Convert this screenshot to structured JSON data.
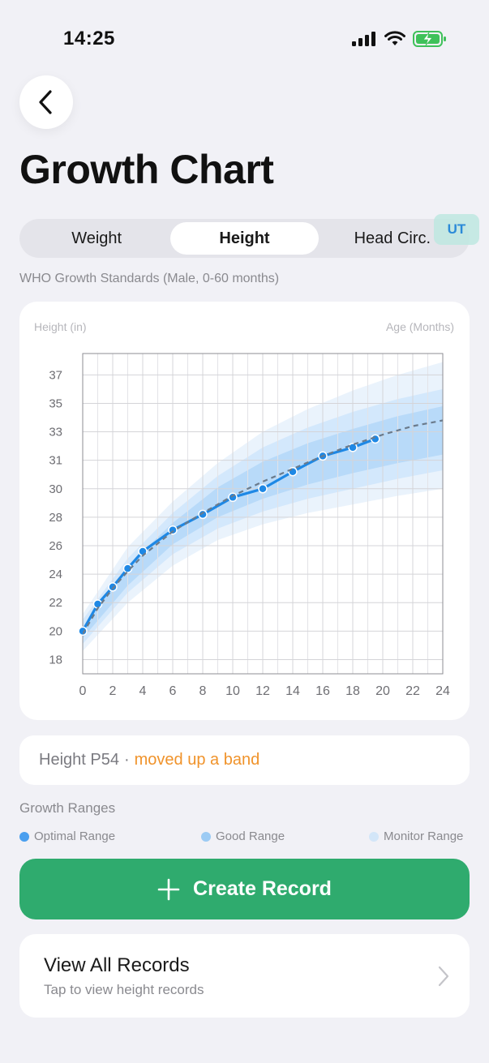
{
  "status_bar": {
    "time": "14:25"
  },
  "page": {
    "title": "Growth Chart"
  },
  "tabs": [
    {
      "label": "Weight",
      "active": false
    },
    {
      "label": "Height",
      "active": true
    },
    {
      "label": "Head Circ.",
      "active": false
    }
  ],
  "badge": {
    "label": "UT"
  },
  "subtitle": "WHO Growth Standards (Male, 0-60 months)",
  "chart_data": {
    "type": "line",
    "ylabel": "Height (in)",
    "xlabel": "Age (Months)",
    "x_ticks": [
      0,
      2,
      4,
      6,
      8,
      10,
      12,
      14,
      16,
      18,
      20,
      22,
      24
    ],
    "y_ticks": [
      "18",
      "20",
      "22",
      "24",
      "26",
      "28",
      "30",
      "31",
      "33",
      "35",
      "37"
    ],
    "xlim": [
      0,
      24
    ],
    "ylim": [
      17,
      39.5
    ],
    "grid": true,
    "series": [
      {
        "style": "solid-with-markers",
        "color": "#1e88e5",
        "points": [
          [
            0,
            20.0
          ],
          [
            1,
            21.9
          ],
          [
            2,
            23.1
          ],
          [
            3,
            24.4
          ],
          [
            4,
            25.6
          ],
          [
            6,
            27.1
          ],
          [
            8,
            28.2
          ],
          [
            10,
            29.4
          ],
          [
            12,
            30.0
          ],
          [
            14,
            31.2
          ],
          [
            16,
            32.3
          ],
          [
            18,
            32.9
          ],
          [
            19.5,
            33.5
          ]
        ]
      },
      {
        "style": "dashed",
        "color": "#6b7b8c",
        "points": [
          [
            0,
            19.8
          ],
          [
            1,
            21.6
          ],
          [
            2,
            23.0
          ],
          [
            3,
            24.2
          ],
          [
            4,
            25.3
          ],
          [
            6,
            27.0
          ],
          [
            8,
            28.3
          ],
          [
            10,
            29.5
          ],
          [
            12,
            30.5
          ],
          [
            14,
            31.4
          ],
          [
            16,
            32.3
          ],
          [
            18,
            33.1
          ],
          [
            20,
            33.8
          ],
          [
            22,
            34.4
          ],
          [
            24,
            34.8
          ]
        ]
      }
    ],
    "bands": [
      {
        "name": "Monitor Range",
        "color": "#e6f1fc",
        "lower": [
          18.6,
          22.0,
          24.6,
          26.4,
          27.5,
          28.3,
          28.9,
          29.5,
          30.0
        ],
        "upper": [
          21.2,
          25.9,
          29.1,
          31.8,
          34.0,
          35.6,
          36.9,
          38.0,
          38.9
        ]
      },
      {
        "name": "Good Range",
        "color": "#cfe5fb",
        "lower": [
          19.1,
          22.7,
          25.4,
          27.2,
          28.4,
          29.3,
          30.0,
          30.7,
          31.3
        ],
        "upper": [
          20.8,
          25.1,
          28.3,
          30.9,
          32.9,
          34.3,
          35.4,
          36.3,
          37.0
        ]
      },
      {
        "name": "Optimal Range",
        "color": "#b3d7f8",
        "lower": [
          19.5,
          23.2,
          26.1,
          28.0,
          29.3,
          30.3,
          31.1,
          31.8,
          32.4
        ],
        "upper": [
          20.3,
          24.6,
          27.6,
          30.1,
          31.9,
          33.2,
          34.2,
          35.1,
          35.8
        ]
      }
    ],
    "band_x": [
      0,
      3,
      6,
      9,
      12,
      15,
      18,
      21,
      24
    ]
  },
  "insight": {
    "main": "Height P54",
    "separator": "·",
    "trend": "moved up a band"
  },
  "ranges": {
    "title": "Growth Ranges",
    "legend": [
      {
        "label": "Optimal Range",
        "color": "#4a9fef"
      },
      {
        "label": "Good Range",
        "color": "#9ccbf4"
      },
      {
        "label": "Monitor Range",
        "color": "#d3e6f8"
      }
    ]
  },
  "actions": {
    "create_label": "Create Record"
  },
  "records": {
    "title": "View All Records",
    "subtitle": "Tap to view height records"
  }
}
